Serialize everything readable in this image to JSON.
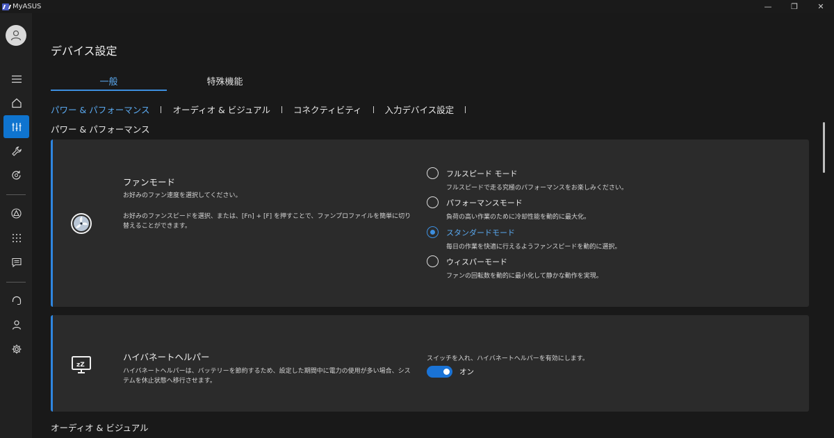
{
  "app": {
    "title": "MyASUS"
  },
  "window": {
    "minimize": "—",
    "maximize": "❐",
    "close": "✕"
  },
  "page": {
    "title": "デバイス設定",
    "tabs": [
      {
        "label": "一般"
      },
      {
        "label": "特殊機能"
      }
    ],
    "subnav": [
      {
        "label": "パワー & パフォーマンス"
      },
      {
        "label": "オーディオ & ビジュアル"
      },
      {
        "label": "コネクティビティ"
      },
      {
        "label": "入力デバイス設定"
      }
    ],
    "section_heading": "パワー & パフォーマンス",
    "next_section_heading": "オーディオ & ビジュアル"
  },
  "fan_mode": {
    "title": "ファンモード",
    "desc1": "お好みのファン速度を選択してください。",
    "desc2": "お好みのファンスピードを選択、または、[Fn] + [F] を押すことで、ファンプロファイルを簡単に切り替えることができます。",
    "options": [
      {
        "label": "フルスピード モード",
        "desc": "フルスピードで走る究極のパフォーマンスをお楽しみください。",
        "selected": false
      },
      {
        "label": "パフォーマンスモード",
        "desc": "負荷の高い作業のために冷却性能を動的に最大化。",
        "selected": false
      },
      {
        "label": "スタンダードモード",
        "desc": "毎日の作業を快適に行えるようファンスピードを動的に選択。",
        "selected": true
      },
      {
        "label": "ウィスパーモード",
        "desc": "ファンの回転数を動的に最小化して静かな動作を実現。",
        "selected": false
      }
    ]
  },
  "hibernate_helper": {
    "title": "ハイバネートヘルパー",
    "desc": "ハイバネートヘルパーは、バッテリーを節約するため、設定した期間中に電力の使用が多い場合、システムを休止状態へ移行させます。",
    "switch_desc": "スイッチを入れ、ハイバネートヘルパーを有効にします。",
    "toggle_label": "オン",
    "enabled": true
  },
  "colors": {
    "accent": "#2f86e0",
    "card_bg": "#2b2b2b",
    "rail_active": "#0f74cf"
  }
}
